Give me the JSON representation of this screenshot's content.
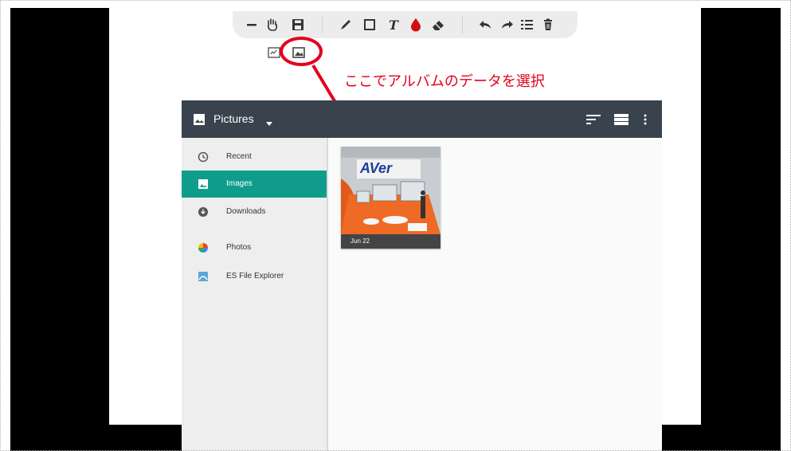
{
  "annotation": {
    "text": "ここでアルバムのデータを選択",
    "color": "#e3001b"
  },
  "toolbar": {
    "icons": [
      "minus-icon",
      "hand-icon",
      "save-icon",
      "pen-icon",
      "rectangle-icon",
      "text-icon",
      "color-drop-icon",
      "eraser-icon",
      "undo-icon",
      "redo-icon",
      "layers-icon",
      "trash-icon"
    ],
    "sub_icons": [
      "whiteboard-icon",
      "image-icon"
    ]
  },
  "picker": {
    "title": "Pictures",
    "nav": [
      {
        "label": "Recent",
        "icon": "clock-icon"
      },
      {
        "label": "Images",
        "icon": "image-icon",
        "active": true
      },
      {
        "label": "Downloads",
        "icon": "download-icon"
      },
      {
        "label": "Photos",
        "icon": "photos-pinwheel-icon"
      },
      {
        "label": "ES File Explorer",
        "icon": "es-file-explorer-icon"
      }
    ],
    "thumbnail": {
      "logo_text": "AVer",
      "date": "Jun 22"
    },
    "colors": {
      "app_bar": "#39434d",
      "accent": "#109c8d"
    }
  }
}
